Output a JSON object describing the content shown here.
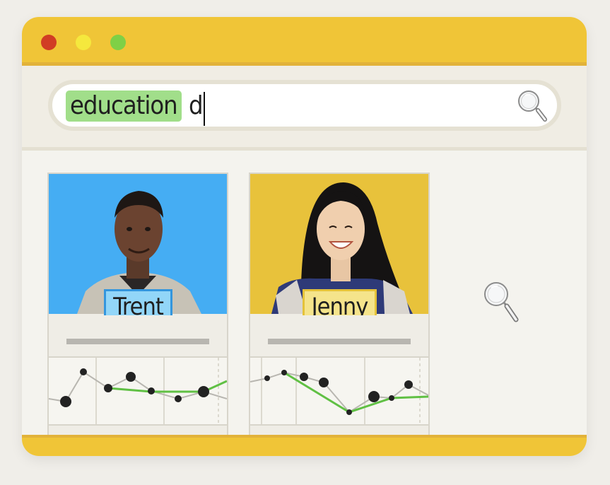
{
  "search": {
    "tag_label": "education",
    "typed_text": "d",
    "tag_color": "#a1de8a"
  },
  "window_controls": {
    "close_color": "#d13d24",
    "minimize_color": "#f5e83d",
    "maximize_color": "#7fd046"
  },
  "results": [
    {
      "name": "Trent",
      "photo_bg": "#45adf3",
      "badge_color": "#92d6f8"
    },
    {
      "name": "Jenny",
      "photo_bg": "#e8c23b",
      "badge_color": "#f5e48b"
    }
  ],
  "icons": {
    "search": "magnifier-icon",
    "empty_state": "magnifier-icon"
  }
}
